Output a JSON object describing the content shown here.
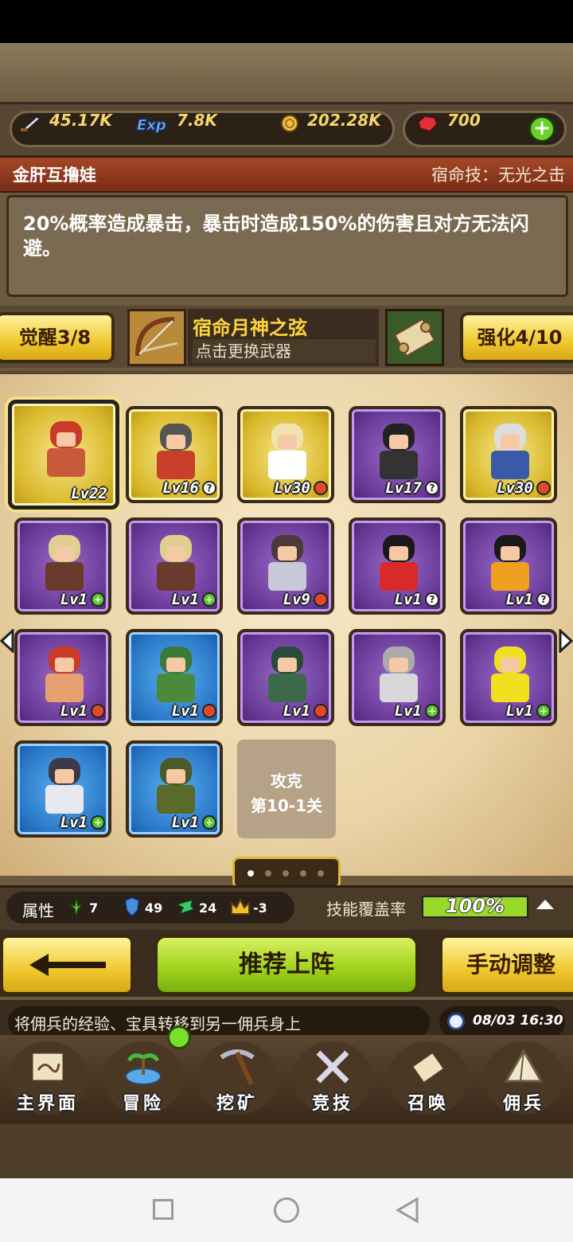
{
  "resources": {
    "attack": "45.17K",
    "exp_label": "Exp",
    "exp": "7.8K",
    "gold": "202.28K",
    "gems": "700"
  },
  "hero": {
    "name": "金肝互撸娃",
    "fate_skill": "宿命技：无光之击",
    "description": "20%概率造成暴击，暴击时造成150%的伤害且对方无法闪避。"
  },
  "weapon": {
    "awaken_label": "觉醒3/8",
    "name": "宿命月神之弦",
    "hint": "点击更换武器",
    "enhance_label": "强化4/10"
  },
  "roster": [
    {
      "level": "Lv22",
      "rarity": "gold",
      "selected": true,
      "badge": "",
      "hair": "#c83a2a",
      "body": "#c85a3a"
    },
    {
      "level": "Lv16",
      "rarity": "gold",
      "selected": false,
      "badge": "q",
      "hair": "#555555",
      "body": "#c8402a"
    },
    {
      "level": "Lv30",
      "rarity": "gold",
      "selected": false,
      "badge": "red",
      "hair": "#f2e2b0",
      "body": "#ffffff"
    },
    {
      "level": "Lv17",
      "rarity": "purple",
      "selected": false,
      "badge": "q",
      "hair": "#222222",
      "body": "#333333"
    },
    {
      "level": "Lv30",
      "rarity": "gold",
      "selected": false,
      "badge": "red",
      "hair": "#dddddd",
      "body": "#3a5aa8"
    },
    {
      "level": "Lv1",
      "rarity": "purple",
      "selected": false,
      "badge": "plus",
      "hair": "#e0d090",
      "body": "#6a3a2a"
    },
    {
      "level": "Lv1",
      "rarity": "purple",
      "selected": false,
      "badge": "plus",
      "hair": "#e0d090",
      "body": "#6a3a2a"
    },
    {
      "level": "Lv9",
      "rarity": "purple",
      "selected": false,
      "badge": "red",
      "hair": "#4a3a3a",
      "body": "#c8c8d8"
    },
    {
      "level": "Lv1",
      "rarity": "purple",
      "selected": false,
      "badge": "q",
      "hair": "#1a1a1a",
      "body": "#d82a2a"
    },
    {
      "level": "Lv1",
      "rarity": "purple",
      "selected": false,
      "badge": "q",
      "hair": "#1a1a1a",
      "body": "#f0a020"
    },
    {
      "level": "Lv1",
      "rarity": "purple",
      "selected": false,
      "badge": "red",
      "hair": "#c83a2a",
      "body": "#e8a070"
    },
    {
      "level": "Lv1",
      "rarity": "blue",
      "selected": false,
      "badge": "red",
      "hair": "#3a7a3a",
      "body": "#4a8a3a"
    },
    {
      "level": "Lv1",
      "rarity": "purple",
      "selected": false,
      "badge": "red",
      "hair": "#2a4a3a",
      "body": "#3a6a4a"
    },
    {
      "level": "Lv1",
      "rarity": "purple",
      "selected": false,
      "badge": "plus",
      "hair": "#aaaaaa",
      "body": "#d8d8d8"
    },
    {
      "level": "Lv1",
      "rarity": "purple",
      "selected": false,
      "badge": "plus",
      "hair": "#f0e020",
      "body": "#f0e020"
    },
    {
      "level": "Lv1",
      "rarity": "blue",
      "selected": false,
      "badge": "plus",
      "hair": "#3a3a4a",
      "body": "#e8e8f0"
    },
    {
      "level": "Lv1",
      "rarity": "blue",
      "selected": false,
      "badge": "plus",
      "hair": "#4a5a2a",
      "body": "#5a6a2a"
    }
  ],
  "stage": {
    "line1": "攻克",
    "line2": "第10-1关"
  },
  "attributes": {
    "label": "属性",
    "values": [
      "7",
      "49",
      "24",
      "-3"
    ],
    "skill_coverage_label": "技能覆盖率",
    "skill_coverage": "100%",
    "skill_coverage_fraction": 1.0
  },
  "actions": {
    "recommend": "推荐上阵",
    "manual": "手动调整"
  },
  "ticker": {
    "text": "将佣兵的经验、宝具转移到另一佣兵身上",
    "time": "08/03 16:30"
  },
  "nav": [
    "主界面",
    "冒险",
    "挖矿",
    "竞技",
    "召唤",
    "佣兵"
  ]
}
